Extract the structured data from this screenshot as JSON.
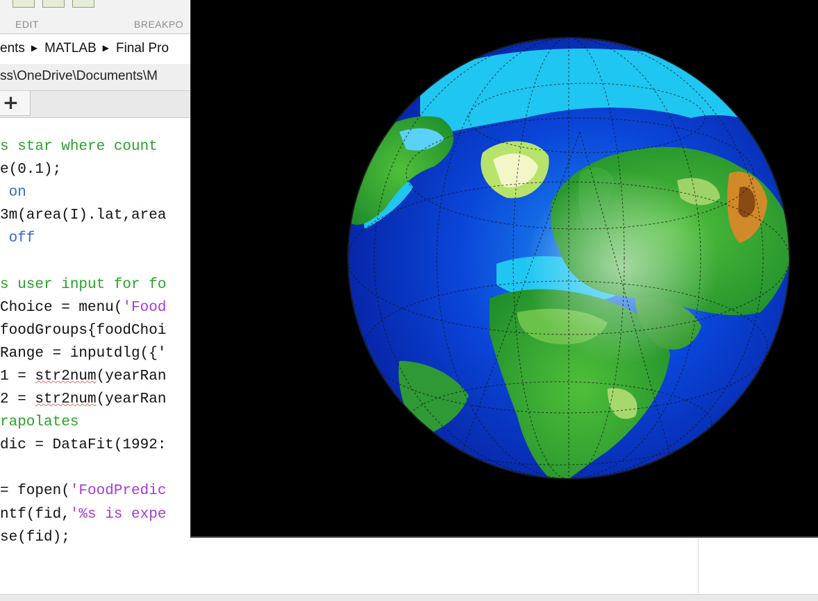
{
  "toolstrip": {
    "sections": [
      "EDIT",
      "BREAKPO"
    ]
  },
  "address_bar": {
    "crumbs": [
      "ents",
      "MATLAB",
      "Final Pro"
    ],
    "separator_icon": "triangle-right-icon"
  },
  "path_bar": {
    "text": "ss\\OneDrive\\Documents\\M"
  },
  "tab_bar": {
    "add_tab_label": "+"
  },
  "editor": {
    "lines": [
      {
        "segments": [
          {
            "t": "s star where count",
            "c": "cmt"
          }
        ]
      },
      {
        "segments": [
          {
            "t": "e(0.1);",
            "c": "plain"
          }
        ]
      },
      {
        "segments": [
          {
            "t": " on",
            "c": "kw"
          }
        ]
      },
      {
        "segments": [
          {
            "t": "3m(area(I).lat,area",
            "c": "plain"
          }
        ]
      },
      {
        "segments": [
          {
            "t": " off",
            "c": "kw"
          }
        ]
      },
      {
        "segments": [
          {
            "t": "",
            "c": "plain"
          }
        ]
      },
      {
        "segments": [
          {
            "t": "s user input for fo",
            "c": "cmt"
          }
        ]
      },
      {
        "segments": [
          {
            "t": "Choice = menu(",
            "c": "plain"
          },
          {
            "t": "'Food",
            "c": "str"
          }
        ]
      },
      {
        "segments": [
          {
            "t": "foodGroups{foodChoi",
            "c": "plain"
          }
        ]
      },
      {
        "segments": [
          {
            "t": "Range = inputdlg({'",
            "c": "plain"
          }
        ]
      },
      {
        "segments": [
          {
            "t": "1 = ",
            "c": "plain"
          },
          {
            "t": "str2num",
            "c": "squig"
          },
          {
            "t": "(yearRan",
            "c": "plain"
          }
        ]
      },
      {
        "segments": [
          {
            "t": "2 = ",
            "c": "plain"
          },
          {
            "t": "str2num",
            "c": "squig"
          },
          {
            "t": "(yearRan",
            "c": "plain"
          }
        ]
      },
      {
        "segments": [
          {
            "t": "rapolates",
            "c": "cmt"
          }
        ]
      },
      {
        "segments": [
          {
            "t": "dic = DataFit(1992:",
            "c": "plain"
          }
        ]
      },
      {
        "segments": [
          {
            "t": "",
            "c": "plain"
          }
        ]
      },
      {
        "segments": [
          {
            "t": "= fopen(",
            "c": "plain"
          },
          {
            "t": "'FoodPredic",
            "c": "str"
          }
        ]
      },
      {
        "segments": [
          {
            "t": "ntf(fid,",
            "c": "plain"
          },
          {
            "t": "'%s is expe",
            "c": "str"
          }
        ]
      },
      {
        "segments": [
          {
            "t": "se(fid);",
            "c": "plain"
          }
        ]
      }
    ]
  },
  "figure": {
    "content": "globe-3d-render",
    "background": "#000000"
  },
  "colors": {
    "comment": "#2ca02c",
    "keyword": "#2f6bd1",
    "string": "#a43ad7",
    "ocean_deep": "#0a2fc4",
    "ocean_shallow": "#19c7f0",
    "land_low": "#1f8f2a",
    "land_high": "#c9821f"
  }
}
